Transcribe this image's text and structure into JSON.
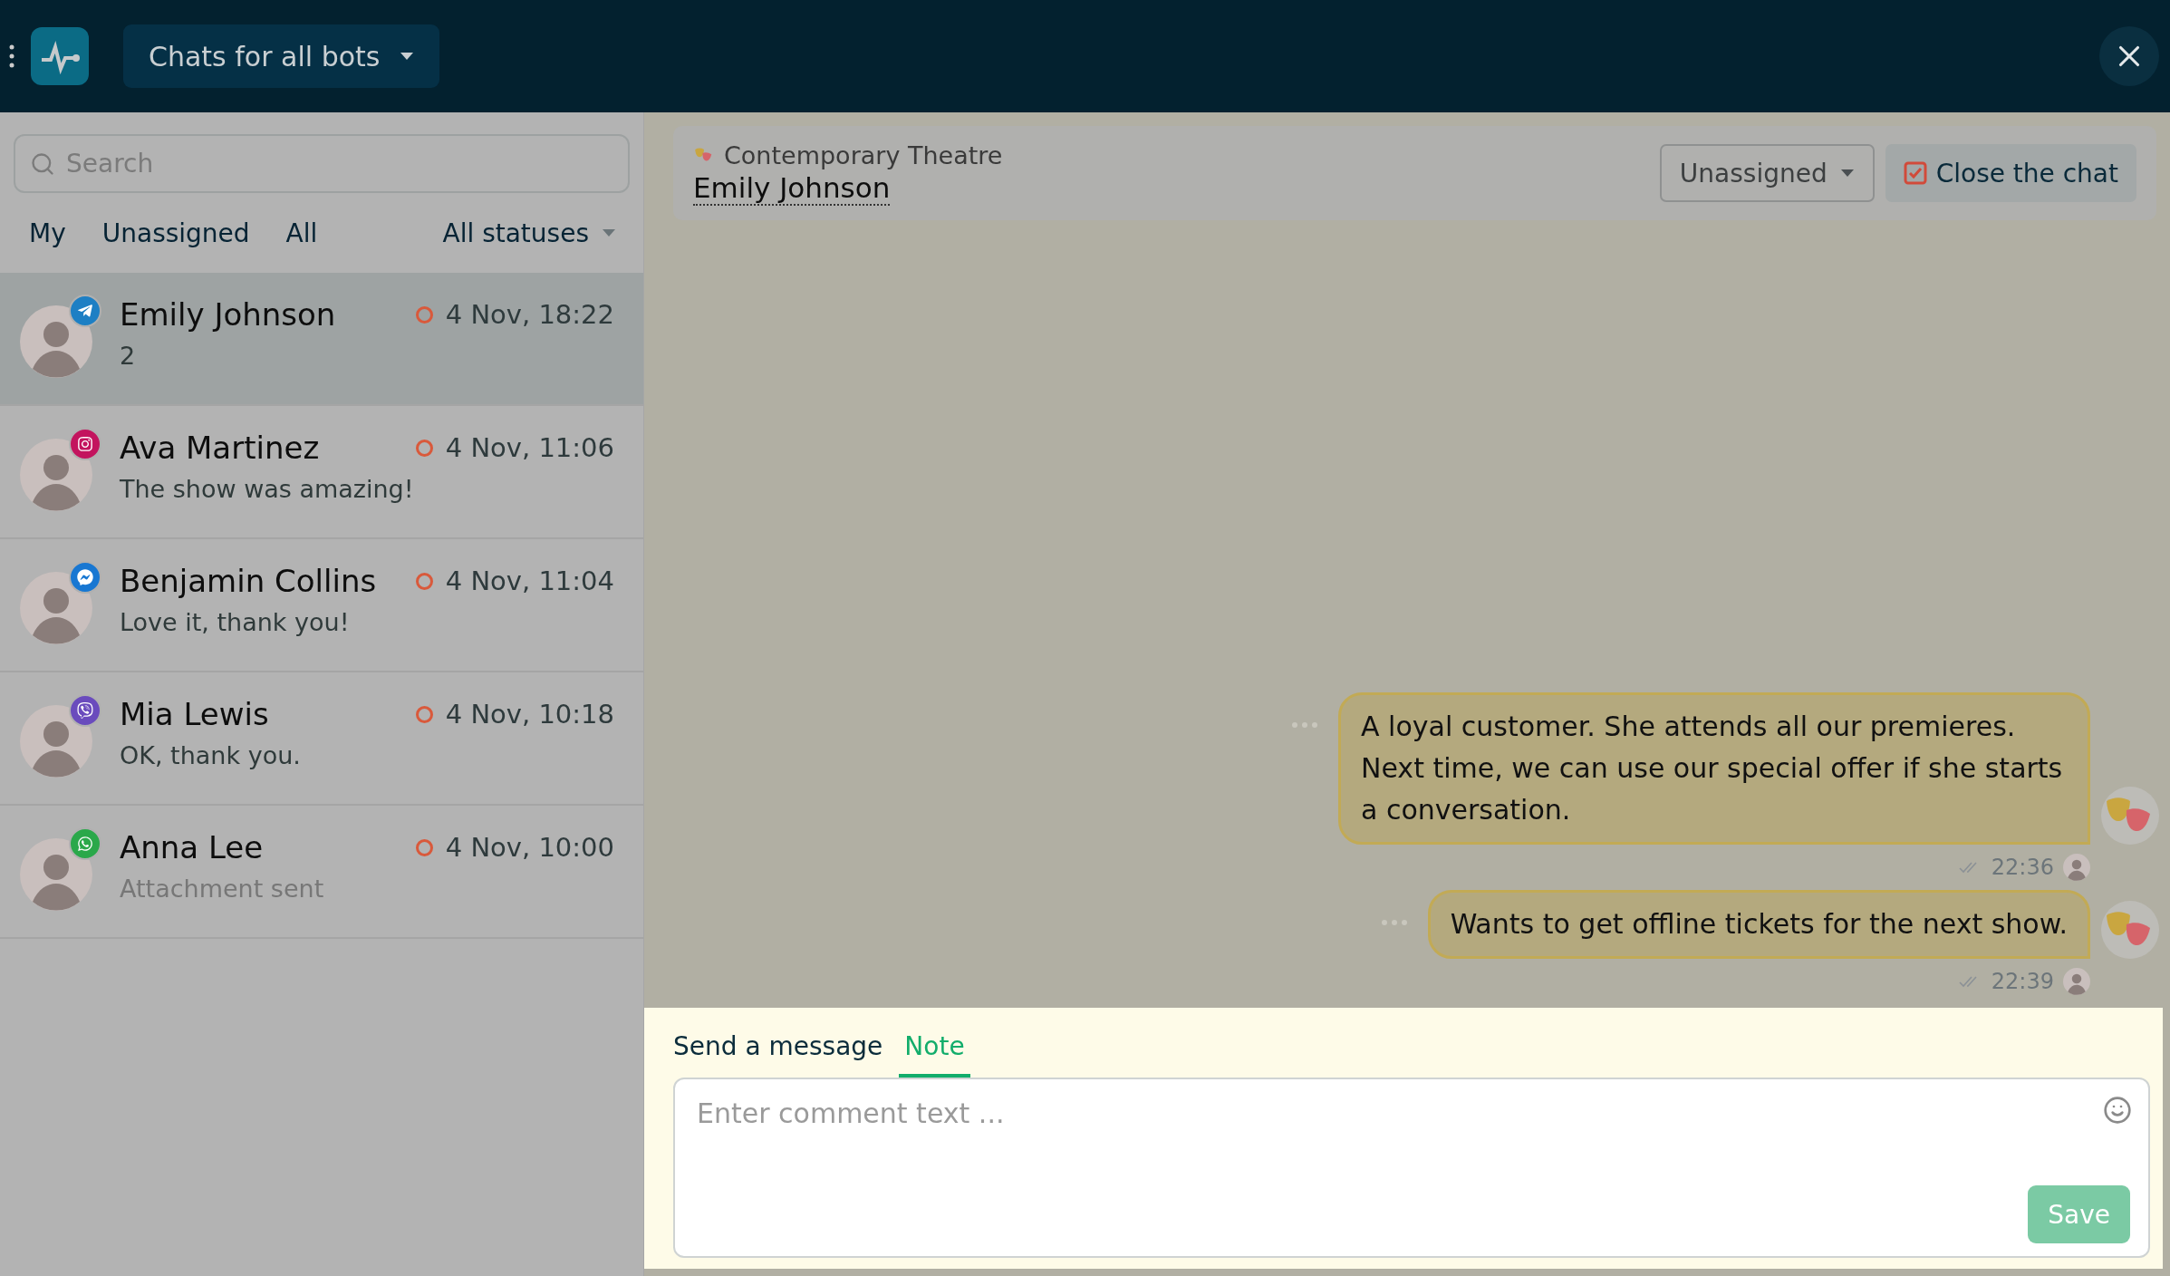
{
  "top_bar": {
    "title": "Chats for all bots"
  },
  "search": {
    "placeholder": "Search"
  },
  "filters": [
    {
      "label": "My"
    },
    {
      "label": "Unassigned"
    },
    {
      "label": "All"
    }
  ],
  "status_filter": "All statuses",
  "chats": [
    {
      "name": "Emily Johnson",
      "time": "4 Nov, 18:22",
      "preview": "2",
      "muted": false,
      "kind": "telegram",
      "selected": true
    },
    {
      "name": "Ava Martinez",
      "time": "4 Nov, 11:06",
      "preview": "The show was amazing!",
      "muted": false,
      "kind": "instagram",
      "selected": false
    },
    {
      "name": "Benjamin Collins",
      "time": "4 Nov, 11:04",
      "preview": "Love it, thank you!",
      "muted": false,
      "kind": "messenger",
      "selected": false
    },
    {
      "name": "Mia Lewis",
      "time": "4 Nov, 10:18",
      "preview": "OK, thank you.",
      "muted": false,
      "kind": "viber",
      "selected": false
    },
    {
      "name": "Anna Lee",
      "time": "4 Nov, 10:00",
      "preview": "Attachment sent",
      "muted": true,
      "kind": "whatsapp",
      "selected": false
    }
  ],
  "chat_header": {
    "bot": "Contemporary Theatre",
    "contact": "Emily Johnson",
    "assignee": "Unassigned",
    "close_button": "Close the chat"
  },
  "messages": [
    {
      "text": "A loyal customer. She attends all our premieres. Next time, we can use our special offer if she starts a conversation.",
      "time": "22:36"
    },
    {
      "text": "Wants to get offline tickets for the next show.",
      "time": "22:39"
    }
  ],
  "composer": {
    "tabs": [
      {
        "label": "Send a message",
        "selected": false
      },
      {
        "label": "Note",
        "selected": true
      }
    ],
    "placeholder": "Enter comment text ...",
    "save_button": "Save"
  }
}
